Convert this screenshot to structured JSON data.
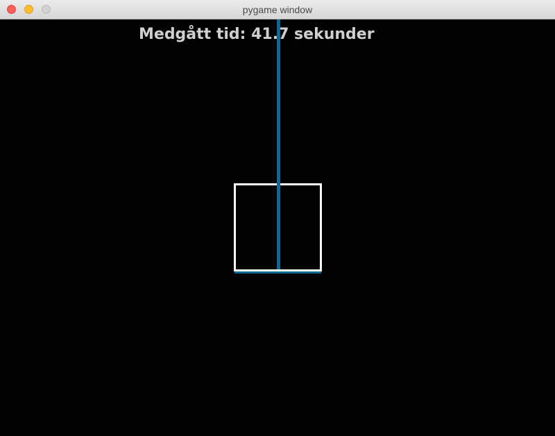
{
  "window": {
    "title": "pygame window"
  },
  "game": {
    "elapsed_label": "Medgått tid: 41.7 sekunder",
    "rope_color": "#0a6a91",
    "block_outline_color": "#ffffff",
    "text_color": "#cfcfcf",
    "background_color": "#020204"
  }
}
